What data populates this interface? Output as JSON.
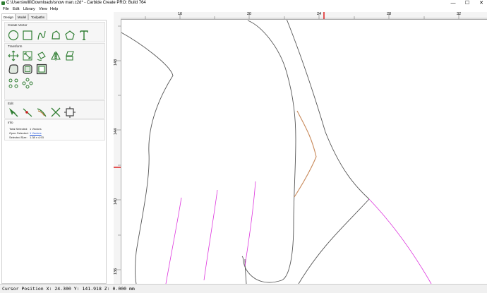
{
  "window": {
    "title": "C:\\Users\\willi\\Downloads\\snow man.c2d* - Carbide Create PRO: Build 764",
    "controls": [
      "—",
      "☐",
      "✕"
    ]
  },
  "menu": [
    "File",
    "Edit",
    "Library",
    "View",
    "Help"
  ],
  "tabs": [
    "Design",
    "Model",
    "Toolpaths"
  ],
  "sections": {
    "create_vector": "Create Vector",
    "transform": "Transform",
    "edit": "Edit",
    "info": "Info"
  },
  "tools": {
    "create_vector": [
      "circle-icon",
      "rectangle-icon",
      "curve-icon",
      "polyline-icon",
      "polygon-icon",
      "text-icon"
    ],
    "transform_row1": [
      "move-icon",
      "scale-icon",
      "rotate-icon",
      "mirror-icon",
      "skew-icon"
    ],
    "transform_row2": [
      "offset-icon",
      "align-center-icon",
      "bounding-box-icon"
    ],
    "transform_row3": [
      "grid-array-icon",
      "circular-array-icon"
    ],
    "edit": [
      "node-edit-icon",
      "trim-icon",
      "join-icon",
      "cut-icon",
      "node-select-icon"
    ]
  },
  "info": {
    "total_selected_label": "Total Selected:",
    "total_selected_value": "1 Vectors",
    "open_selected_label": "Open Selected:",
    "open_selected_value": "1 Vectors",
    "selected_size_label": "Selected Size:",
    "selected_size_value": "1.38 x 4.93"
  },
  "ruler": {
    "x_labels": [
      "16",
      "20",
      "24",
      "28",
      "32"
    ],
    "y_labels": [
      "148",
      "144",
      "140",
      "136"
    ]
  },
  "colors": {
    "accent": "#2f7d32",
    "vector_default": "#555555",
    "vector_magenta": "#dd33dd",
    "vector_selected": "#c8895a",
    "cursor_marker": "#dd1111"
  },
  "status": {
    "text": "Cursor Position X: 24.300 Y: 141.918 Z: 0.000 mm"
  }
}
